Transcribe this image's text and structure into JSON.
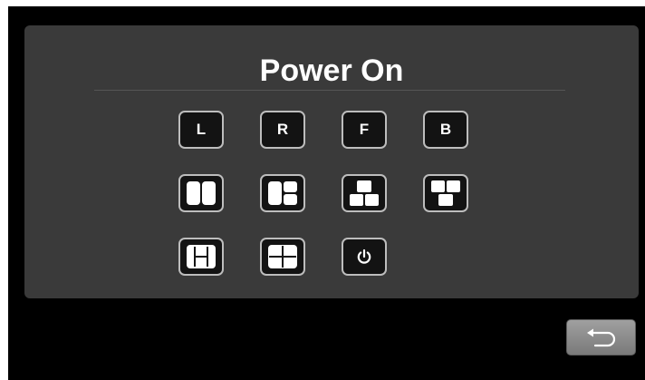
{
  "screen": {
    "title": "Power On",
    "camera_buttons": [
      {
        "label": "L"
      },
      {
        "label": "R"
      },
      {
        "label": "F"
      },
      {
        "label": "B"
      }
    ],
    "layout_buttons": [
      {
        "icon": "split-two-vertical-icon"
      },
      {
        "icon": "split-one-plus-two-icon"
      },
      {
        "icon": "pyramid-three-icon"
      },
      {
        "icon": "inverted-pyramid-three-icon"
      },
      {
        "icon": "split-three-column-icon"
      },
      {
        "icon": "quad-split-icon"
      },
      {
        "icon": "power-icon"
      }
    ],
    "back_button": {
      "icon": "back-arrow-icon"
    }
  },
  "colors": {
    "background": "#000000",
    "panel": "#3a3a3a",
    "button_fill": "#131313",
    "button_border": "#bdbdbd",
    "text": "#ffffff"
  }
}
